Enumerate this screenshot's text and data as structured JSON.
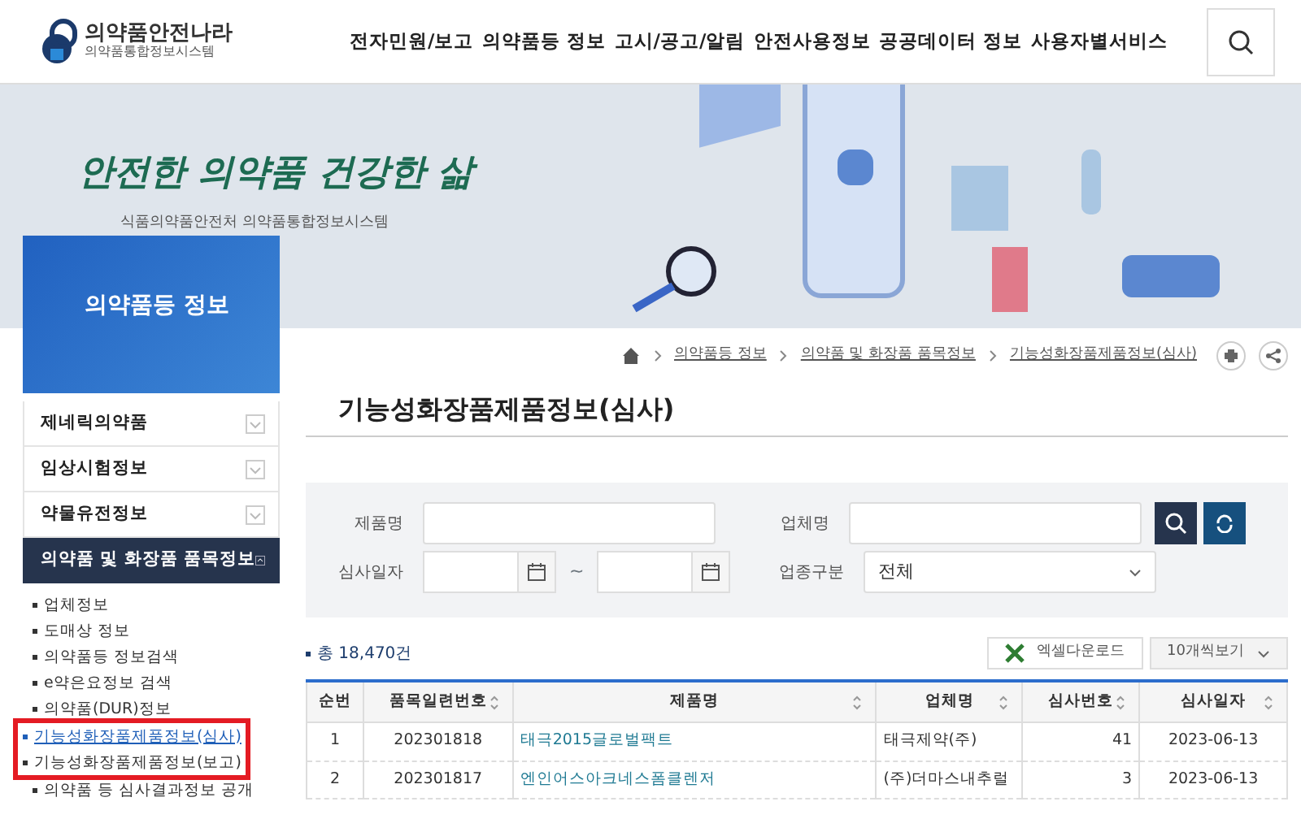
{
  "header": {
    "logo_title": "의약품안전나라",
    "logo_subtitle": "의약품통합정보시스템",
    "nav": [
      "전자민원/보고",
      "의약품등 정보",
      "고시/공고/알림",
      "안전사용정보",
      "공공데이터 정보",
      "사용자별서비스"
    ]
  },
  "banner": {
    "slogan": "안전한 의약품 건강한 삶",
    "subtitle": "식품의약품안전처 의약품통합정보시스템"
  },
  "sidebar": {
    "title": "의약품등 정보",
    "menus": [
      {
        "label": "제네릭의약품",
        "expanded": false
      },
      {
        "label": "임상시험정보",
        "expanded": false
      },
      {
        "label": "약물유전정보",
        "expanded": false
      },
      {
        "label": "의약품 및 화장품 품목정보",
        "expanded": true,
        "children": [
          {
            "label": "업체정보",
            "selected": false,
            "highlighted": false
          },
          {
            "label": "도매상 정보",
            "selected": false,
            "highlighted": false
          },
          {
            "label": "의약품등 정보검색",
            "selected": false,
            "highlighted": false
          },
          {
            "label": "e약은요정보 검색",
            "selected": false,
            "highlighted": false
          },
          {
            "label": "의약품(DUR)정보",
            "selected": false,
            "highlighted": false
          },
          {
            "label": "기능성화장품제품정보(심사)",
            "selected": true,
            "highlighted": true
          },
          {
            "label": "기능성화장품제품정보(보고)",
            "selected": false,
            "highlighted": true
          },
          {
            "label": "의약품 등 심사결과정보 공개",
            "selected": false,
            "highlighted": false
          }
        ]
      }
    ]
  },
  "breadcrumb": [
    "의약품등 정보",
    "의약품 및 화장품 품목정보",
    "기능성화장품제품정보(심사)"
  ],
  "page_title": "기능성화장품제품정보(심사)",
  "search": {
    "product_label": "제품명",
    "company_label": "업체명",
    "date_label": "심사일자",
    "date_separator": "~",
    "type_label": "업종구분",
    "type_value": "전체"
  },
  "total": "총 18,470건",
  "excel_button": "엑셀다운로드",
  "page_size": "10개씩보기",
  "table": {
    "columns": [
      {
        "label": "순번",
        "sortable": false
      },
      {
        "label": "품목일련번호",
        "sortable": true
      },
      {
        "label": "제품명",
        "sortable": true
      },
      {
        "label": "업체명",
        "sortable": true
      },
      {
        "label": "심사번호",
        "sortable": true
      },
      {
        "label": "심사일자",
        "sortable": true
      }
    ],
    "rows": [
      [
        "1",
        "202301818",
        "태극2015글로벌팩트",
        "태극제약(주)",
        "41",
        "2023-06-13"
      ],
      [
        "2",
        "202301817",
        "엔인어스아크네스폼클렌저",
        "(주)더마스내추럴",
        "3",
        "2023-06-13"
      ]
    ]
  }
}
